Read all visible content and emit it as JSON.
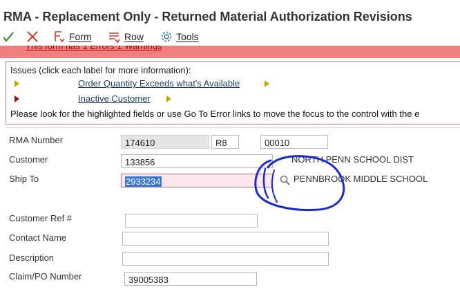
{
  "window": {
    "title": "RMA - Replacement Only - Returned Material Authorization Revisions"
  },
  "toolbar": {
    "ok_icon": "check-icon",
    "cancel_icon": "close-icon",
    "form_label": "Form",
    "form_hotkey": "F",
    "row_label": "Row",
    "row_hotkey": "R",
    "tools_label": "Tools",
    "tools_hotkey": "T"
  },
  "error_banner": {
    "partial_text": "This form has 1 Errors 1 Warnings"
  },
  "issues": {
    "heading": "Issues (click each label for more information):",
    "items": [
      {
        "label": "Order Quantity Exceeds what's Available",
        "severity": "warning",
        "color": "#c8a800"
      },
      {
        "label": "Inactive Customer",
        "severity": "error",
        "color": "#a01010"
      }
    ],
    "footer": "Please look for the highlighted fields or use Go To Error links to move the focus to the control with the e"
  },
  "form": {
    "rma_number": {
      "label": "RMA Number",
      "number": "174610",
      "type": "R8",
      "company": "00010"
    },
    "customer": {
      "label": "Customer",
      "value": "133856",
      "description": "NORTH PENN SCHOOL DIST"
    },
    "ship_to": {
      "label": "Ship To",
      "value": "2933234",
      "description": "PENNBROOK MIDDLE SCHOOL",
      "search_icon": "magnifier-icon"
    },
    "customer_ref": {
      "label": "Customer Ref #",
      "value": ""
    },
    "contact_name": {
      "label": "Contact Name",
      "value": ""
    },
    "description": {
      "label": "Description",
      "value": ""
    },
    "claim_po": {
      "label": "Claim/PO Number",
      "value": "39005383"
    }
  },
  "colors": {
    "error_strip": "#f08080",
    "link": "#1b3d6d",
    "annotation_ink": "#1a2bc8",
    "selection": "#3875d7"
  }
}
